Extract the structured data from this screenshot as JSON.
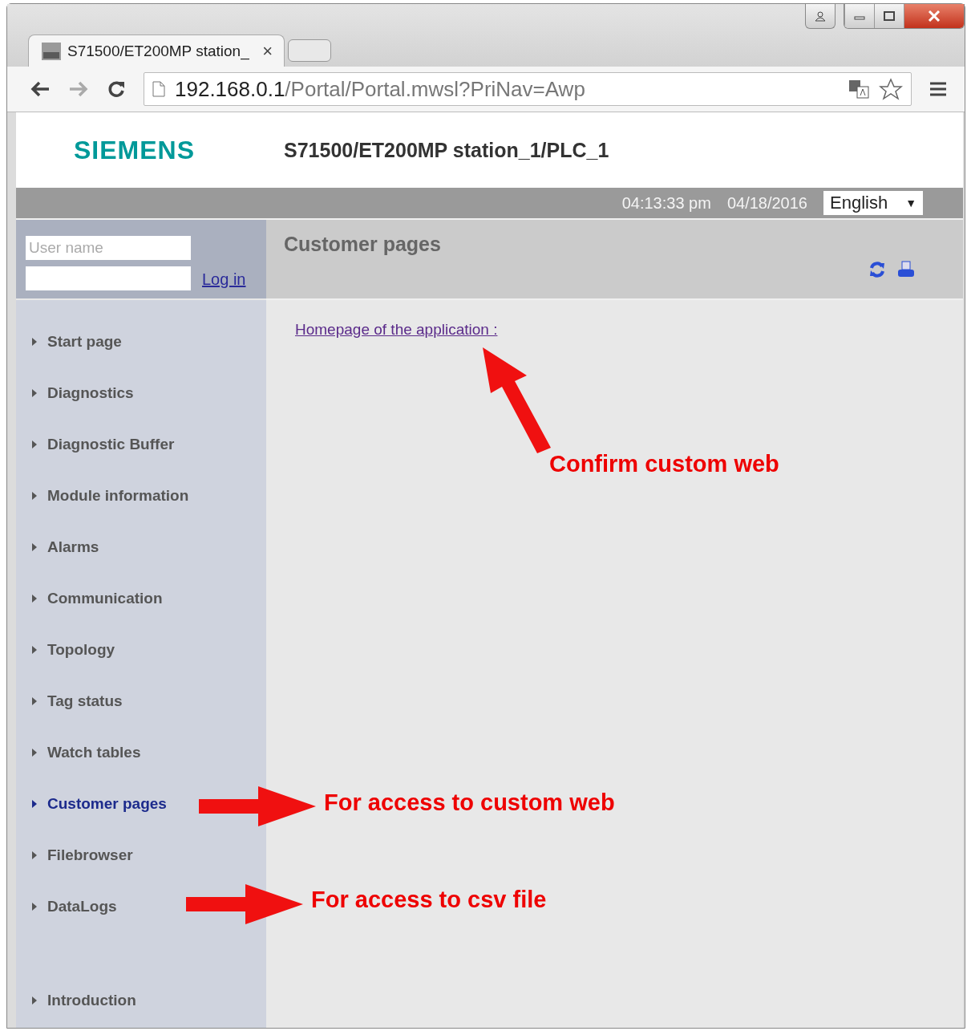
{
  "browser": {
    "tabs": [
      {
        "title": "S71500/ET200MP station_",
        "close": "×",
        "selected": true
      },
      {
        "kind": "new"
      }
    ],
    "address": {
      "host": "192.168.0.1",
      "path": "/Portal/Portal.mwsl?PriNav=Awp"
    }
  },
  "header": {
    "logo": "SIEMENS",
    "station": "S71500/ET200MP station_1/PLC_1"
  },
  "status_bar": {
    "time": "04:13:33 pm",
    "date": "04/18/2016",
    "language": "English",
    "dropdown_arrow": "▼"
  },
  "login": {
    "username_placeholder": "User name",
    "login_link": "Log in"
  },
  "sidebar": {
    "items": [
      {
        "label": "Start page",
        "selected": false
      },
      {
        "label": "Diagnostics",
        "selected": false
      },
      {
        "label": "Diagnostic Buffer",
        "selected": false
      },
      {
        "label": "Module information",
        "selected": false
      },
      {
        "label": "Alarms",
        "selected": false
      },
      {
        "label": "Communication",
        "selected": false
      },
      {
        "label": "Topology",
        "selected": false
      },
      {
        "label": "Tag status",
        "selected": false
      },
      {
        "label": "Watch tables",
        "selected": false
      },
      {
        "label": "Customer pages",
        "selected": true
      },
      {
        "label": "Filebrowser",
        "selected": false
      },
      {
        "label": "DataLogs",
        "selected": false
      }
    ],
    "footer_item": {
      "label": "Introduction",
      "selected": false
    }
  },
  "content": {
    "title": "Customer pages",
    "link": "Homepage of the application :"
  },
  "annotations": [
    {
      "text": "Confirm custom web",
      "kind": "diagonal"
    },
    {
      "text": "For access to custom web",
      "kind": "right"
    },
    {
      "text": "For access to csv file",
      "kind": "right"
    }
  ]
}
